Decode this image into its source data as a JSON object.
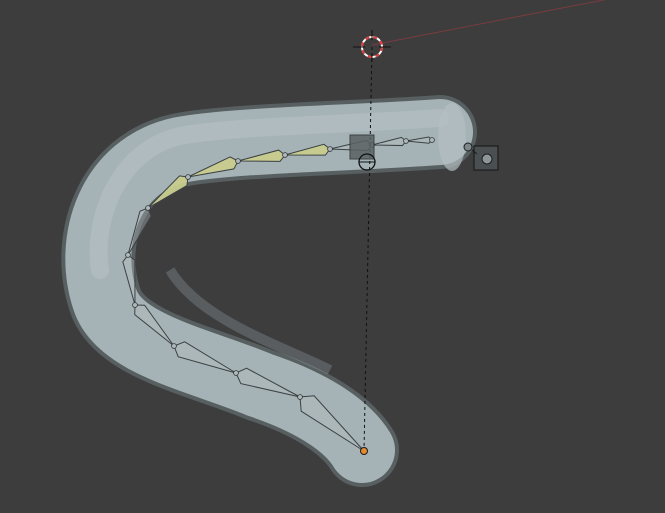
{
  "viewport": {
    "background": "#3d3d3d",
    "grid_line_color": "#484848"
  },
  "scene": {
    "mesh_name": "tube-mesh",
    "mesh_color": "#a7b4b8",
    "mesh_shadow_color": "#6d7a7e",
    "bone_color": "#b9c0c2",
    "bone_selected_color": "#c8cc8e",
    "bone_count": 13,
    "selected_bone_count": 4,
    "cursor_color_primary": "#e03a3a",
    "cursor_color_secondary": "#ffffff",
    "active_tip_color": "#e38a2c",
    "x_axis_color": "#8a3b40"
  },
  "icons": {
    "cursor": "3d-cursor-icon",
    "empty": "empty-cube-icon",
    "camera_target": "camera-target-icon"
  }
}
